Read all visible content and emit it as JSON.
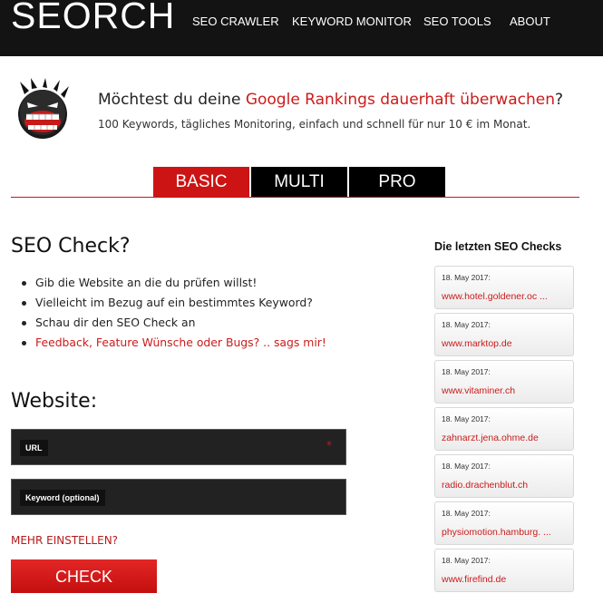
{
  "header": {
    "logo": "SEORCH",
    "nav": [
      "SEO CRAWLER",
      "KEYWORD MONITOR",
      "SEO TOOLS",
      "ABOUT"
    ]
  },
  "promo": {
    "mascot_icon": "angry-grinning-face-icon",
    "headline_pre": "Möchtest du deine ",
    "headline_link": "Google Rankings dauerhaft überwachen",
    "headline_post": "?",
    "subline": "100 Keywords, tägliches Monitoring, einfach und schnell für nur 10 € im Monat."
  },
  "tabs": [
    {
      "label": "BASIC",
      "active": true
    },
    {
      "label": "MULTI",
      "active": false
    },
    {
      "label": "PRO",
      "active": false
    }
  ],
  "seo_check": {
    "title": "SEO Check?",
    "steps": [
      "Gib die Website an die du prüfen willst!",
      "Vielleicht im Bezug auf ein bestimmtes Keyword?",
      "Schau dir den SEO Check an",
      "Feedback, Feature Wünsche oder Bugs? .. sags mir!"
    ]
  },
  "form": {
    "title": "Website:",
    "url_label": "URL",
    "url_required_mark": "*",
    "keyword_label": "Keyword (optional)",
    "more_settings": "MEHR EINSTELLEN?",
    "submit_label": "CHECK"
  },
  "sidebar": {
    "title": "Die letzten SEO Checks",
    "items": [
      {
        "date": "18. May 2017:",
        "url": "www.hotel.goldener.oc ..."
      },
      {
        "date": "18. May 2017:",
        "url": "www.marktop.de"
      },
      {
        "date": "18. May 2017:",
        "url": "www.vitaminer.ch"
      },
      {
        "date": "18. May 2017:",
        "url": "zahnarzt.jena.ohme.de"
      },
      {
        "date": "18. May 2017:",
        "url": "radio.drachenblut.ch"
      },
      {
        "date": "18. May 2017:",
        "url": "physiomotion.hamburg. ..."
      },
      {
        "date": "18. May 2017:",
        "url": "www.firefind.de"
      }
    ]
  },
  "colors": {
    "accent": "#cc1414",
    "topbar": "#131313",
    "field_bg": "#222222"
  }
}
